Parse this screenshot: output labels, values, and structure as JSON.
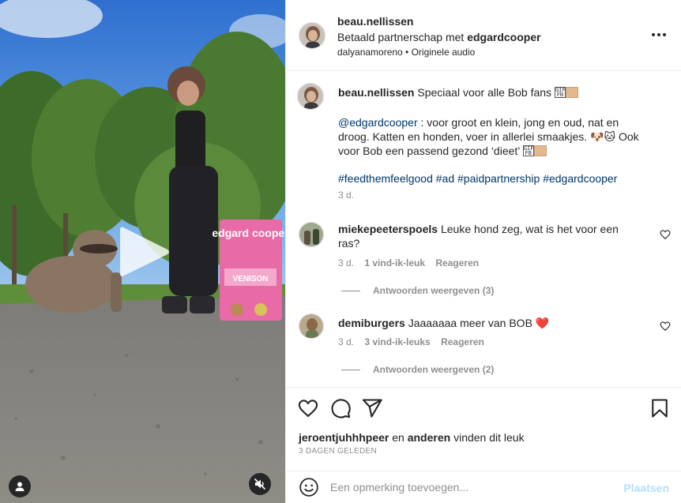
{
  "header": {
    "username": "beau.nellissen",
    "partnership_prefix": "Betaald partnerschap met ",
    "partner": "edgardcooper",
    "audio": "dalyanamoreno • Originele audio"
  },
  "caption": {
    "username": "beau.nellissen",
    "line1": "Speciaal voor alle Bob fans",
    "mention": "@edgardcooper",
    "body1": " : voor groot en klein, jong en oud, nat en",
    "body2": "droog. Katten en honden, voer in allerlei smaakjes. 🐶🐱 Ook",
    "body3": "voor Bob een passend gezond ‘dieet’",
    "hashtags": "#feedthemfeelgood #ad #paidpartnership #edgardcooper",
    "time": "3 d."
  },
  "comments": [
    {
      "username": "miekepeeterspoels",
      "text_line1": "Leuke hond zeg, wat is het voor een",
      "text_line2": "ras?",
      "time": "3 d.",
      "likes": "1 vind-ik-leuk",
      "reply": "Reageren",
      "view_replies": "Antwoorden weergeven (3)"
    },
    {
      "username": "demiburgers",
      "text_line1": "Jaaaaaaa meer van BOB ❤️",
      "time": "3 d.",
      "likes": "3 vind-ik-leuks",
      "reply": "Reageren",
      "view_replies": "Antwoorden weergeven (2)"
    }
  ],
  "likes": {
    "user": "jeroentjuhhhpeer",
    "and": " en ",
    "others": "anderen",
    "suffix": " vinden dit leuk"
  },
  "post_date": "3 DAGEN GELEDEN",
  "add_comment": {
    "placeholder": "Een opmerking toevoegen...",
    "post_label": "Plaatsen"
  },
  "icons": {
    "like": "heart-icon",
    "comment": "comment-icon",
    "share": "paper-plane-icon",
    "save": "bookmark-icon",
    "more": "more-dots-icon",
    "emoji": "smiley-icon",
    "play": "play-icon",
    "mute": "speaker-muted-icon",
    "tags": "user-tag-icon"
  },
  "colors": {
    "link": "#00376b",
    "muted": "#8e8e8e",
    "post_button": "#b2dffc",
    "heart_red": "#ed4956"
  },
  "product_bag": {
    "brand": "edgard cooper",
    "flavor": "VENISON"
  }
}
